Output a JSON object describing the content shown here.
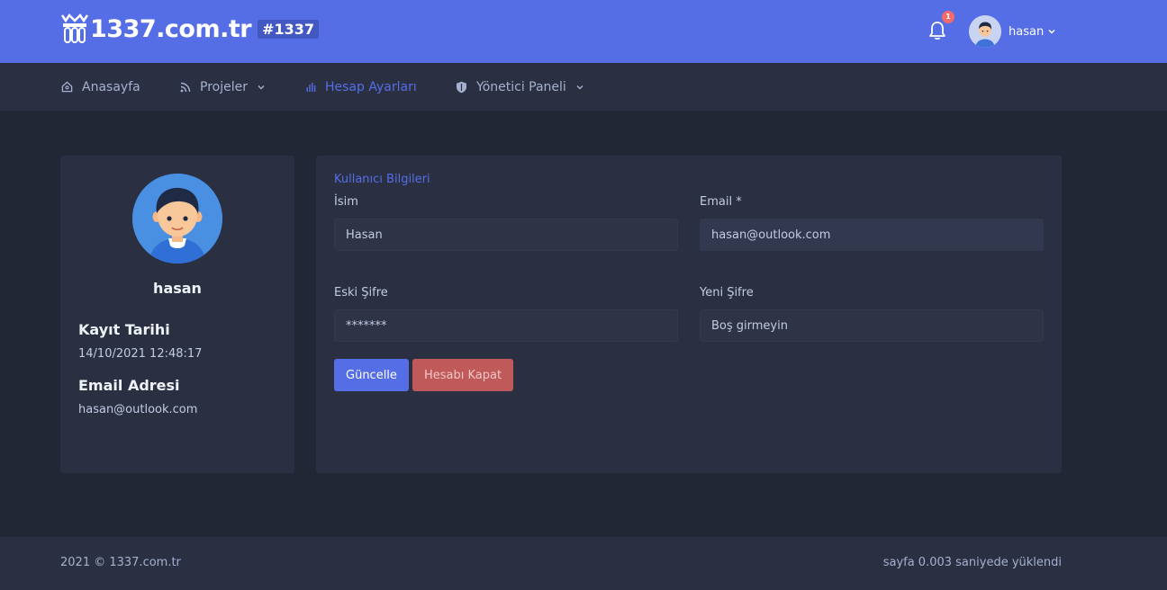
{
  "header": {
    "logo_text": "1337.com.tr",
    "logo_tag": "#1337",
    "notification_count": "1",
    "user_name": "hasan",
    "icons": [
      "logo-icon",
      "bell-icon",
      "avatar",
      "chevron-down-icon"
    ]
  },
  "nav": {
    "items": [
      {
        "label": "Anasayfa",
        "icon": "home-icon",
        "has_dropdown": false,
        "active": false
      },
      {
        "label": "Projeler",
        "icon": "rss-icon",
        "has_dropdown": true,
        "active": false
      },
      {
        "label": "Hesap Ayarları",
        "icon": "bar-chart-icon",
        "has_dropdown": false,
        "active": true
      },
      {
        "label": "Yönetici Paneli",
        "icon": "shield-icon",
        "has_dropdown": true,
        "active": false
      }
    ]
  },
  "profile": {
    "name": "hasan",
    "registered_label": "Kayıt Tarihi",
    "registered_value": "14/10/2021 12:48:17",
    "email_label": "Email Adresi",
    "email_value": "hasan@outlook.com"
  },
  "form": {
    "section_title": "Kullanıcı Bilgileri",
    "name_label": "İsim",
    "name_value": "Hasan",
    "email_label": "Email *",
    "email_value": "hasan@outlook.com",
    "old_password_label": "Eski Şifre",
    "old_password_value": "*******",
    "new_password_label": "Yeni Şifre",
    "new_password_placeholder": "Boş girmeyin",
    "update_button": "Güncelle",
    "close_account_button": "Hesabı Kapat"
  },
  "footer": {
    "copyright": "2021 © 1337.com.tr",
    "load_time": "sayfa 0.003 saniyede yüklendi"
  },
  "colors": {
    "accent": "#556ee6",
    "background": "#222736",
    "card": "#2a3042",
    "danger": "#c0595a",
    "badge": "#f46a6a"
  }
}
